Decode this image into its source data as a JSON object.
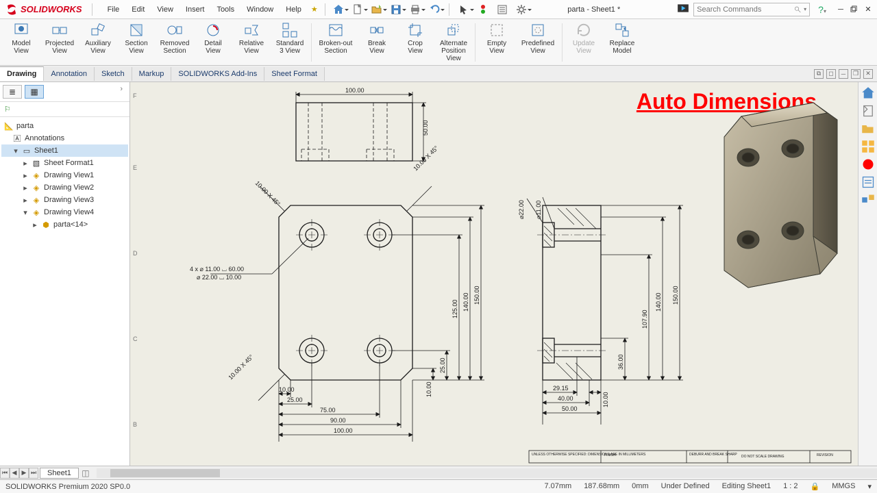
{
  "app": {
    "logo_text": "SOLIDWORKS"
  },
  "menu": [
    "File",
    "Edit",
    "View",
    "Insert",
    "Tools",
    "Window",
    "Help"
  ],
  "doc_title": "parta - Sheet1 *",
  "search_placeholder": "Search Commands",
  "ribbon": [
    {
      "l1": "Model",
      "l2": "View"
    },
    {
      "l1": "Projected",
      "l2": "View"
    },
    {
      "l1": "Auxiliary",
      "l2": "View"
    },
    {
      "l1": "Section",
      "l2": "View"
    },
    {
      "l1": "Removed",
      "l2": "Section"
    },
    {
      "l1": "Detail",
      "l2": "View"
    },
    {
      "l1": "Relative",
      "l2": "View"
    },
    {
      "l1": "Standard",
      "l2": "3 View"
    },
    {
      "l1": "Broken-out",
      "l2": "Section"
    },
    {
      "l1": "Break",
      "l2": "View"
    },
    {
      "l1": "Crop",
      "l2": "View"
    },
    {
      "l1": "Alternate",
      "l2": "Position",
      "l3": "View"
    },
    {
      "l1": "Empty",
      "l2": "View"
    },
    {
      "l1": "Predefined",
      "l2": "View"
    },
    {
      "l1": "Update",
      "l2": "View",
      "disabled": true
    },
    {
      "l1": "Replace",
      "l2": "Model"
    }
  ],
  "tabs": [
    "Drawing",
    "Annotation",
    "Sketch",
    "Markup",
    "SOLIDWORKS Add-Ins",
    "Sheet Format"
  ],
  "tree": {
    "root": "parta",
    "ann": "Annotations",
    "sheet": "Sheet1",
    "sf": "Sheet Format1",
    "dv1": "Drawing View1",
    "dv2": "Drawing View2",
    "dv3": "Drawing View3",
    "dv4": "Drawing View4",
    "child": "parta<14>"
  },
  "overlay_title": "Auto Dimensions",
  "dims": {
    "top_w": "100.00",
    "top_h": "50.00",
    "chamfer": "10.00 X 45°",
    "hole_note_1": "4 x ⌀ 11.00 ⌴ 60.00",
    "hole_note_2": "⌀ 22.00 ⌴ 10.00",
    "h_10": "10.00",
    "h_25": "25.00",
    "h_75": "75.00",
    "h_90": "90.00",
    "h_100": "100.00",
    "v_10": "10.00",
    "v_25": "25.00",
    "v_125": "125.00",
    "v_140": "140.00",
    "v_150": "150.00",
    "side_d22": "⌀22.00",
    "side_d11": "⌀11.00",
    "side_29": "29.15",
    "side_40": "40.00",
    "side_50": "50.00",
    "side_10b": "10.00",
    "side_36": "36.00",
    "side_107": "107.90",
    "side_140": "140.00",
    "side_150": "150.00"
  },
  "titleblock": {
    "notes": "UNLESS OTHERWISE SPECIFIED:\nDIMENSIONS ARE IN MILLIMETERS",
    "finish": "FINISH:",
    "edges": "DEBURR AND\nBREAK SHARP",
    "scale": "DO NOT SCALE DRAWING",
    "rev": "REVISION"
  },
  "sheet_tab": "Sheet1",
  "status": {
    "product": "SOLIDWORKS Premium 2020 SP0.0",
    "x": "7.07mm",
    "y": "187.68mm",
    "z": "0mm",
    "state": "Under Defined",
    "edit": "Editing Sheet1",
    "scale": "1 : 2",
    "units": "MMGS"
  }
}
